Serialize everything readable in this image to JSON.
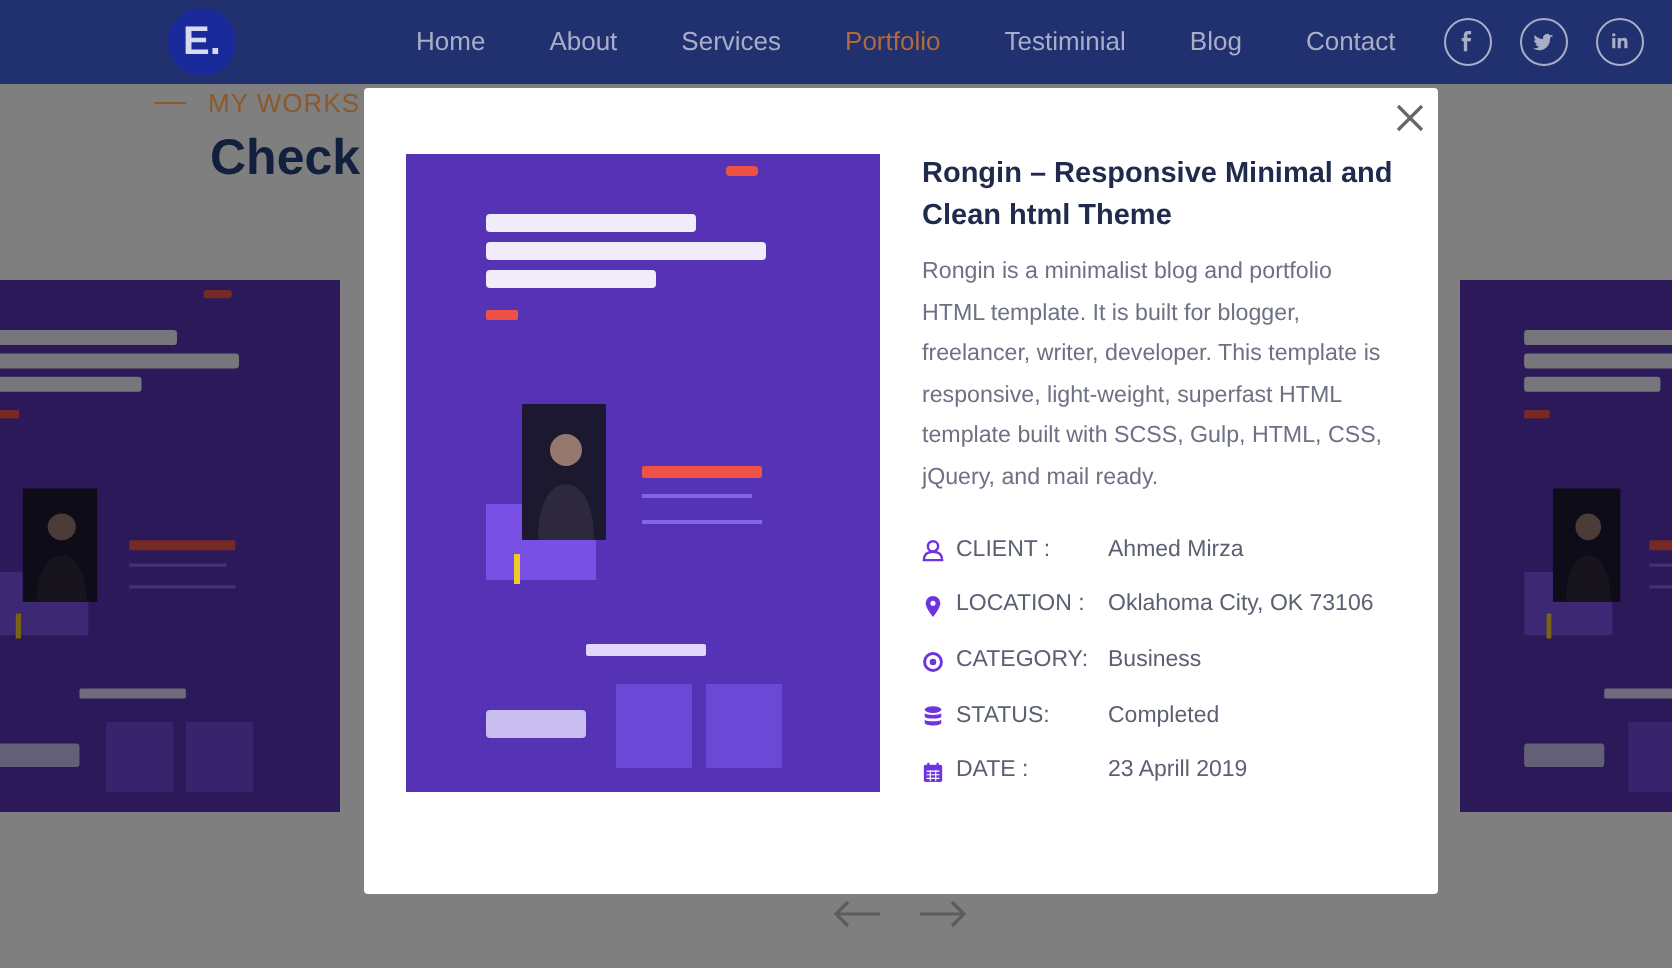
{
  "navbar": {
    "logo": "E.",
    "links": [
      {
        "label": "Home",
        "selected": false
      },
      {
        "label": "About",
        "selected": false
      },
      {
        "label": "Services",
        "selected": false
      },
      {
        "label": "Portfolio",
        "selected": true
      },
      {
        "label": "Testiminial",
        "selected": false
      },
      {
        "label": "Blog",
        "selected": false
      },
      {
        "label": "Contact",
        "selected": false
      }
    ],
    "social": [
      {
        "kind": "facebook"
      },
      {
        "kind": "twitter"
      },
      {
        "kind": "linkedin"
      }
    ]
  },
  "section": {
    "eyebrow": "MY WORKS",
    "heading": "Check"
  },
  "modal": {
    "title": "Rongin – Responsive Minimal and Clean html Theme",
    "description": "Rongin is a minimalist blog and portfolio HTML template. It is built for blogger, freelancer, writer, developer. This template is responsive, light-weight, superfast HTML template built with SCSS, Gulp, HTML, CSS, jQuery, and mail ready.",
    "details": [
      {
        "kind": "client",
        "label": "CLIENT :",
        "value": "Ahmed Mirza"
      },
      {
        "kind": "location",
        "label": "LOCATION :",
        "value": "Oklahoma City, OK 73106"
      },
      {
        "kind": "category",
        "label": "CATEGORY:",
        "value": "Business"
      },
      {
        "kind": "status",
        "label": "STATUS:",
        "value": "Completed"
      },
      {
        "kind": "date",
        "label": "DATE :",
        "value": "23 Aprill 2019"
      }
    ]
  }
}
